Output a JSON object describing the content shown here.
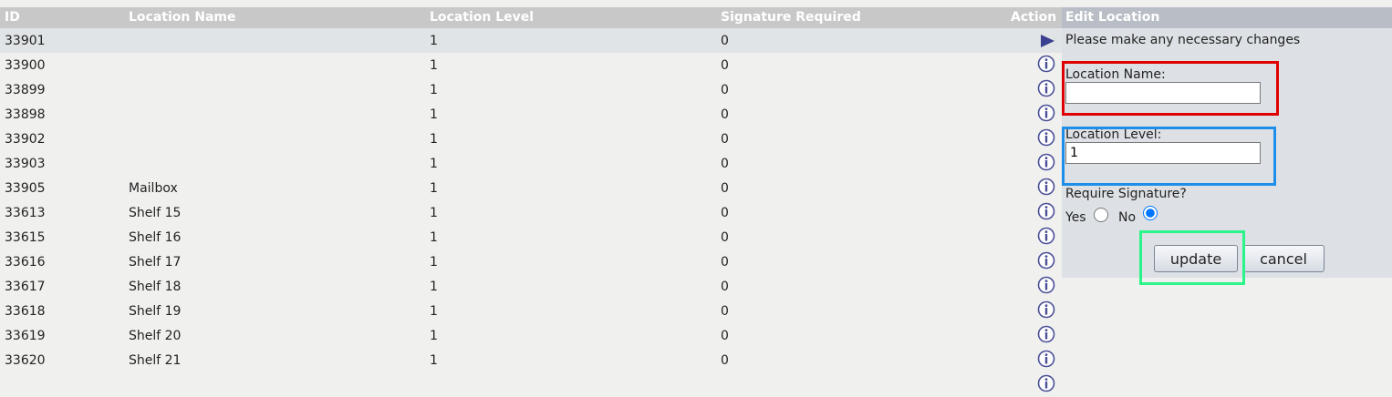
{
  "table": {
    "headers": {
      "id": "ID",
      "name": "Location Name",
      "level": "Location Level",
      "signature": "Signature Required",
      "action": "Action"
    },
    "rows": [
      {
        "id": "33901",
        "name": "",
        "level": "1",
        "signature": "0",
        "action_icon": "arrow-right-icon",
        "selected": true
      },
      {
        "id": "33900",
        "name": "",
        "level": "1",
        "signature": "0",
        "action_icon": "info-icon"
      },
      {
        "id": "33899",
        "name": "",
        "level": "1",
        "signature": "0",
        "action_icon": "info-icon"
      },
      {
        "id": "33898",
        "name": "",
        "level": "1",
        "signature": "0",
        "action_icon": "info-icon"
      },
      {
        "id": "33902",
        "name": "",
        "level": "1",
        "signature": "0",
        "action_icon": "info-icon"
      },
      {
        "id": "33903",
        "name": "",
        "level": "1",
        "signature": "0",
        "action_icon": "info-icon"
      },
      {
        "id": "33905",
        "name": "Mailbox",
        "level": "1",
        "signature": "0",
        "action_icon": "info-icon"
      },
      {
        "id": "33613",
        "name": "Shelf 15",
        "level": "1",
        "signature": "0",
        "action_icon": "info-icon"
      },
      {
        "id": "33615",
        "name": "Shelf 16",
        "level": "1",
        "signature": "0",
        "action_icon": "info-icon"
      },
      {
        "id": "33616",
        "name": "Shelf 17",
        "level": "1",
        "signature": "0",
        "action_icon": "info-icon"
      },
      {
        "id": "33617",
        "name": "Shelf 18",
        "level": "1",
        "signature": "0",
        "action_icon": "info-icon"
      },
      {
        "id": "33618",
        "name": "Shelf 19",
        "level": "1",
        "signature": "0",
        "action_icon": "info-icon"
      },
      {
        "id": "33619",
        "name": "Shelf 20",
        "level": "1",
        "signature": "0",
        "action_icon": "info-icon"
      },
      {
        "id": "33620",
        "name": "Shelf 21",
        "level": "1",
        "signature": "0",
        "action_icon": "info-icon"
      }
    ],
    "partial_row_icon": "info-icon"
  },
  "edit_panel": {
    "title": "Edit Location",
    "instructions": "Please make any necessary changes",
    "location_name_label": "Location Name:",
    "location_name_value": "",
    "location_level_label": "Location Level:",
    "location_level_value": "1",
    "require_signature_label": "Require Signature?",
    "yes_label": "Yes",
    "no_label": "No",
    "require_signature_selected": "No",
    "update_label": "update",
    "cancel_label": "cancel"
  },
  "colors": {
    "header_bg": "#c8c8c8",
    "panel_title_bg": "#b8bdc6",
    "panel_bg": "#dde1e5",
    "selected_row_bg": "#e1e4e6",
    "icon_color": "#3b3f8f",
    "highlight_red": "#e00000",
    "highlight_blue": "#1e8ee8",
    "highlight_green": "#2af58a"
  }
}
